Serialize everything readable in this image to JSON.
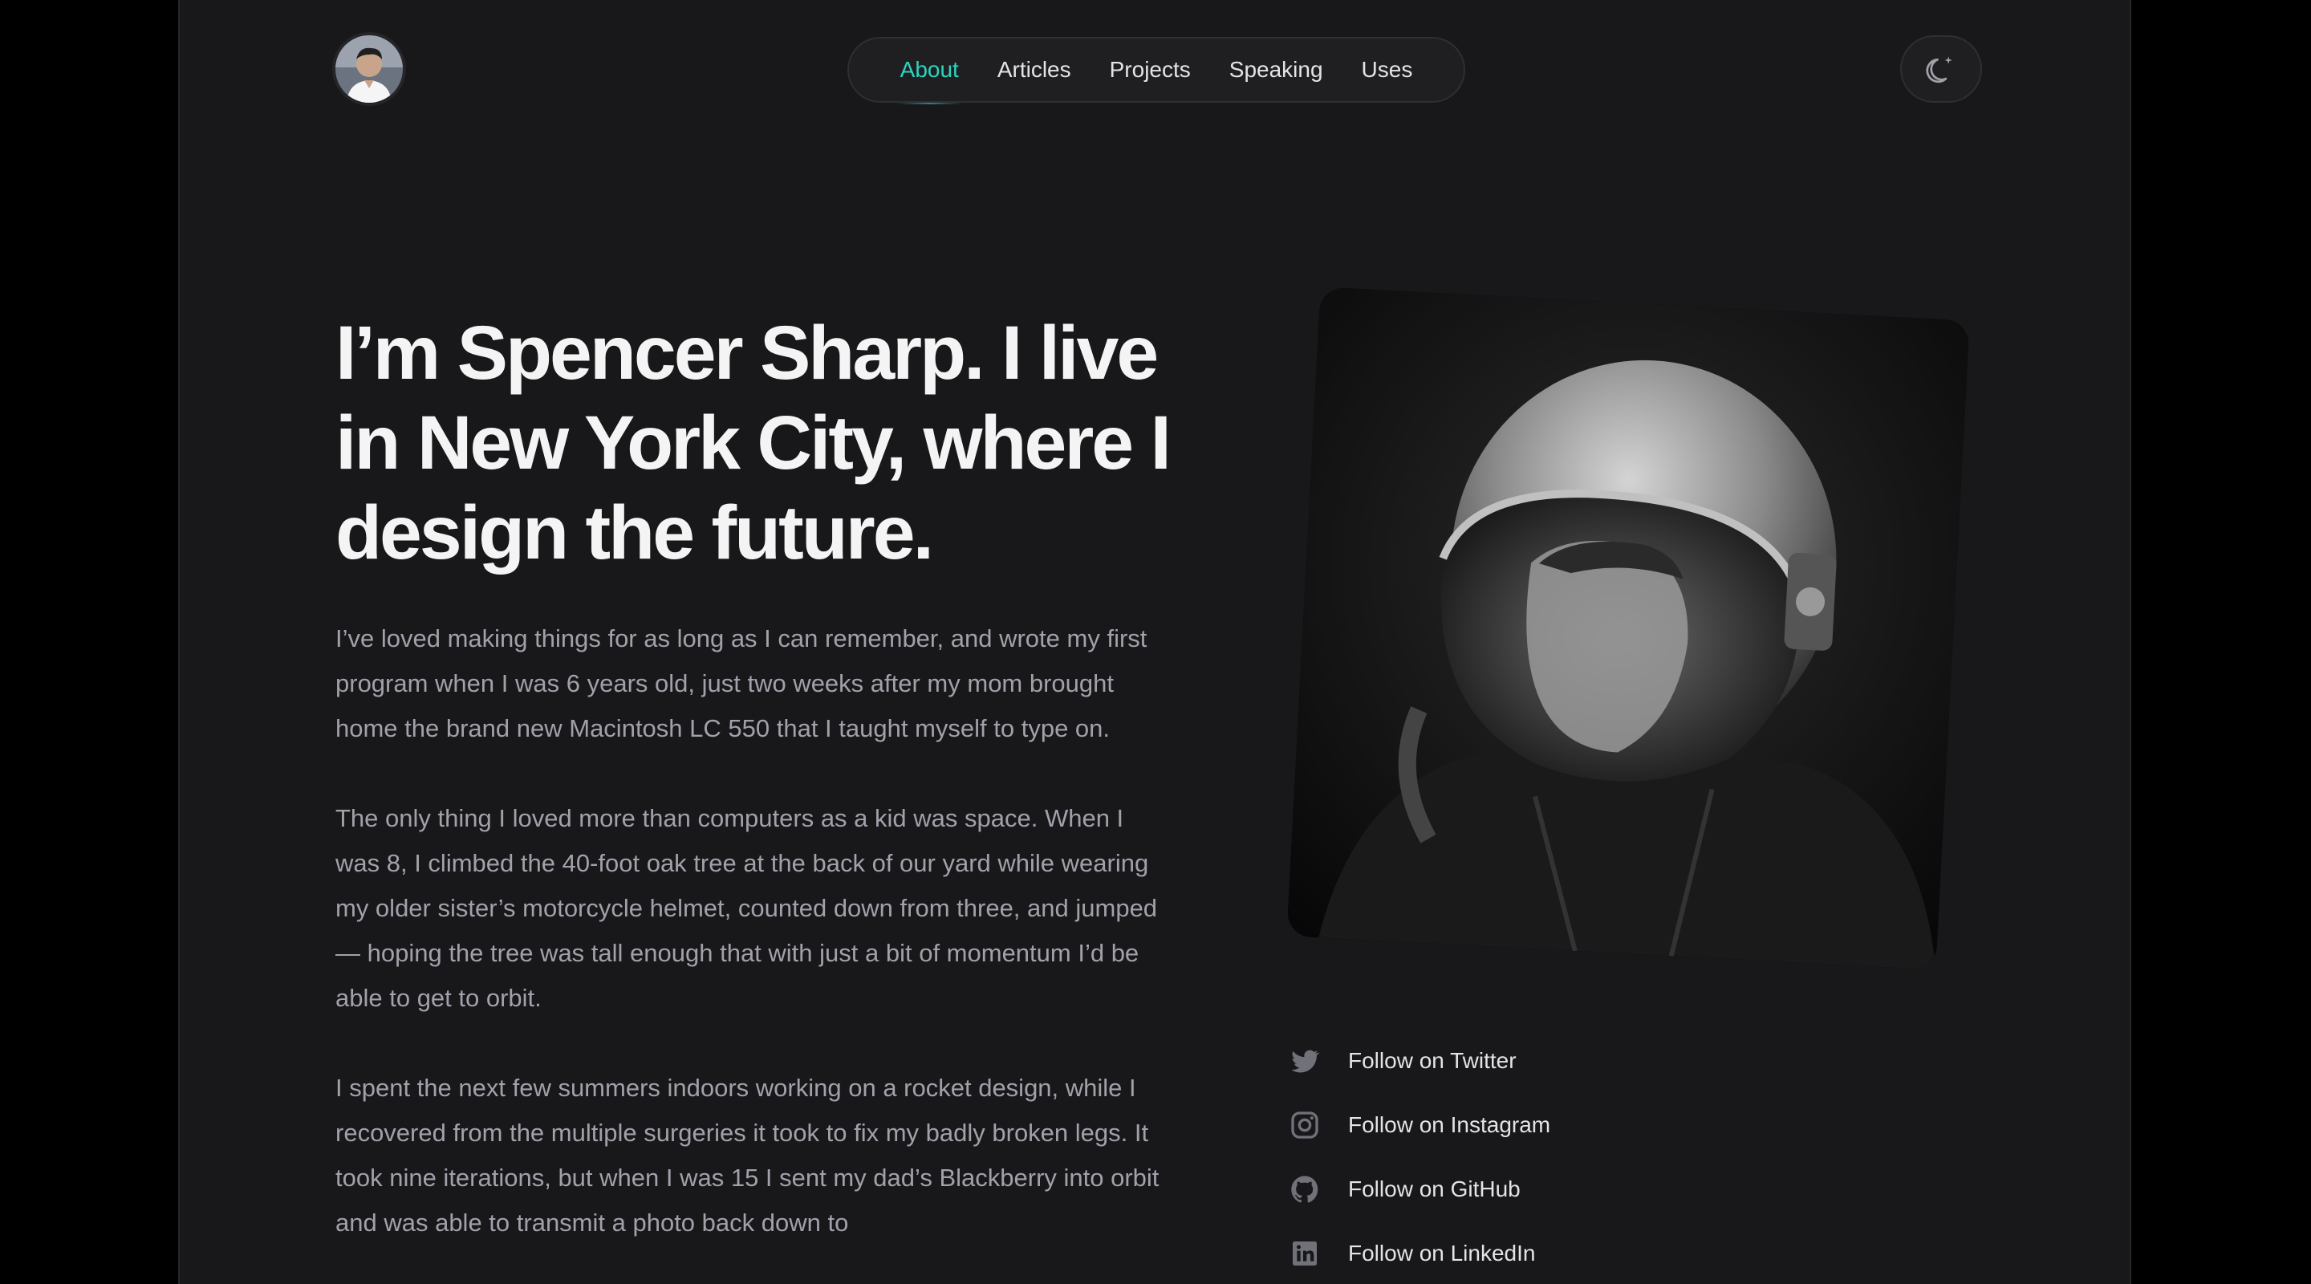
{
  "header": {
    "nav": [
      {
        "label": "About",
        "active": true
      },
      {
        "label": "Articles",
        "active": false
      },
      {
        "label": "Projects",
        "active": false
      },
      {
        "label": "Speaking",
        "active": false
      },
      {
        "label": "Uses",
        "active": false
      }
    ],
    "avatar_icon": "avatar-photo",
    "theme_toggle_icon": "moon-sparkle-icon"
  },
  "hero": {
    "headline": "I’m Spencer Sharp. I live in New York City, where I design the future.",
    "paragraphs": [
      "I’ve loved making things for as long as I can remember, and wrote my first program when I was 6 years old, just two weeks after my mom brought home the brand new Macintosh LC 550 that I taught myself to type on.",
      "The only thing I loved more than computers as a kid was space. When I was 8, I climbed the 40-foot oak tree at the back of our yard while wearing my older sister’s motorcycle helmet, counted down from three, and jumped — hoping the tree was tall enough that with just a bit of momentum I’d be able to get to orbit.",
      "I spent the next few summers indoors working on a rocket design, while I recovered from the multiple surgeries it took to fix my badly broken legs. It took nine iterations, but when I was 15 I sent my dad’s Blackberry into orbit and was able to transmit a photo back down to"
    ]
  },
  "social": [
    {
      "label": "Follow on Twitter",
      "icon": "twitter-icon"
    },
    {
      "label": "Follow on Instagram",
      "icon": "instagram-icon"
    },
    {
      "label": "Follow on GitHub",
      "icon": "github-icon"
    },
    {
      "label": "Follow on LinkedIn",
      "icon": "linkedin-icon"
    }
  ],
  "colors": {
    "accent": "#2dd4bf",
    "background": "#18181b",
    "outer": "#000000",
    "heading": "#f4f4f5",
    "body": "#a1a1aa",
    "icon": "#71717a"
  }
}
